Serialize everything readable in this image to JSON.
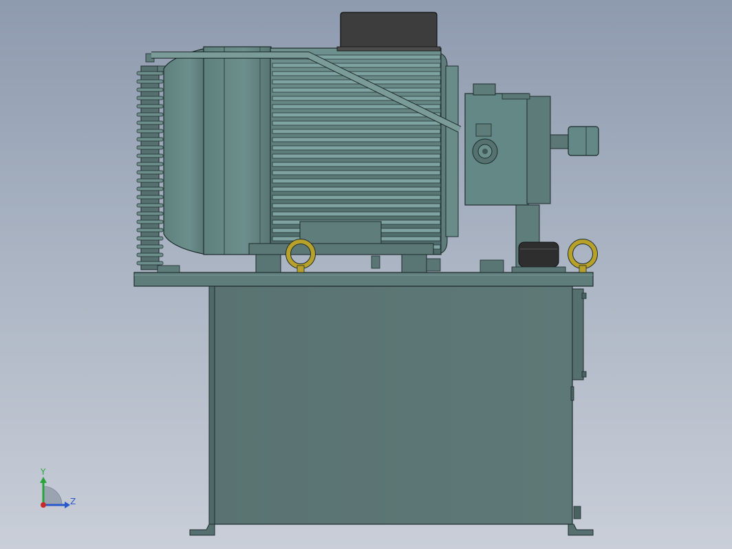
{
  "viewport": {
    "background_top": "#8e9aae",
    "background_bottom": "#c9ced8"
  },
  "model": {
    "body_color": "#5b7674",
    "highlight_color": "#7fa3a0",
    "terminal_box_color": "#3d3d3d",
    "eyebolt_color": "#b8a12a",
    "breather_cap_color": "#2e2e2e",
    "edge_color": "#1c2a2a"
  },
  "triad": {
    "y_label": "Y",
    "z_label": "Z",
    "y_color": "#2aa33a",
    "z_color": "#2a58c8",
    "x_color": "#c82a2a"
  }
}
